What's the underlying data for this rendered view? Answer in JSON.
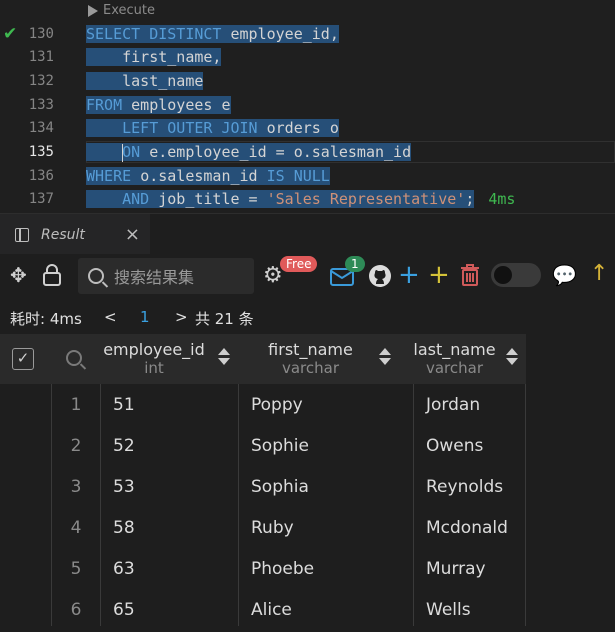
{
  "editor": {
    "codelens": "Execute",
    "lines": [
      {
        "num": "130",
        "check": true,
        "active": false,
        "parts": [
          [
            "kw",
            "SELECT DISTINCT"
          ],
          [
            "",
            "employee_id,"
          ]
        ]
      },
      {
        "num": "131",
        "check": false,
        "active": false,
        "parts": [
          [
            "",
            "    first_name,"
          ]
        ]
      },
      {
        "num": "132",
        "check": false,
        "active": false,
        "parts": [
          [
            "",
            "    last_name"
          ]
        ]
      },
      {
        "num": "133",
        "check": false,
        "active": false,
        "parts": [
          [
            "kw",
            "FROM"
          ],
          [
            "",
            "employees e"
          ]
        ]
      },
      {
        "num": "134",
        "check": false,
        "active": false,
        "parts": [
          [
            "kw",
            "    LEFT OUTER JOIN"
          ],
          [
            "",
            "orders o"
          ]
        ]
      },
      {
        "num": "135",
        "check": false,
        "active": true,
        "parts": [
          [
            "kw",
            "    ON"
          ],
          [
            "",
            "e.employee_id = o.salesman_id"
          ]
        ]
      },
      {
        "num": "136",
        "check": false,
        "active": false,
        "parts": [
          [
            "kw",
            "WHERE"
          ],
          [
            "",
            "o.salesman_id"
          ],
          [
            "kw",
            "IS NULL"
          ]
        ]
      },
      {
        "num": "137",
        "check": false,
        "active": false,
        "parts": [
          [
            "kw",
            "    AND"
          ],
          [
            "",
            "job_title ="
          ],
          [
            "str",
            "'Sales Representative'"
          ],
          [
            "",
            ";"
          ]
        ],
        "timing": "4ms"
      }
    ]
  },
  "panel": {
    "tab_label": "Result",
    "tab_close": "×",
    "search_placeholder": "搜索结果集",
    "free_badge": "Free",
    "mail_count": "1"
  },
  "pager": {
    "elapsed": "耗时: 4ms",
    "prev": "<",
    "page": "1",
    "next": ">",
    "total": "共 21 条"
  },
  "grid": {
    "columns": [
      {
        "name": "employee_id",
        "type": "int"
      },
      {
        "name": "first_name",
        "type": "varchar"
      },
      {
        "name": "last_name",
        "type": "varchar"
      }
    ],
    "rows": [
      {
        "n": "1",
        "employee_id": "51",
        "first_name": "Poppy",
        "last_name": "Jordan"
      },
      {
        "n": "2",
        "employee_id": "52",
        "first_name": "Sophie",
        "last_name": "Owens"
      },
      {
        "n": "3",
        "employee_id": "53",
        "first_name": "Sophia",
        "last_name": "Reynolds"
      },
      {
        "n": "4",
        "employee_id": "58",
        "first_name": "Ruby",
        "last_name": "Mcdonald"
      },
      {
        "n": "5",
        "employee_id": "63",
        "first_name": "Phoebe",
        "last_name": "Murray"
      },
      {
        "n": "6",
        "employee_id": "65",
        "first_name": "Alice",
        "last_name": "Wells"
      }
    ]
  },
  "colors": {
    "accent_check": "#3fb950",
    "free_badge": "#e05a5a",
    "mail_badge": "#2e8b57"
  }
}
